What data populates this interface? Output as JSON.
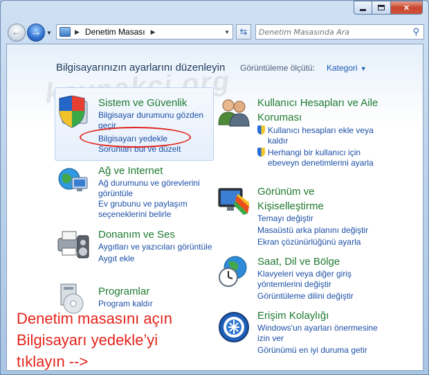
{
  "address": {
    "location": "Denetim Masası",
    "icon": "control-panel-icon"
  },
  "search": {
    "placeholder": "Denetim Masasında Ara"
  },
  "header": {
    "title": "Bilgisayarınızın ayarlarını düzenleyin",
    "view_by_label": "Görüntüleme ölçütü:",
    "view_by_value": "Kategori"
  },
  "watermark": "kaynakci.org",
  "categories_left": [
    {
      "title": "Sistem ve Güvenlik",
      "icon": "shield-pc-icon",
      "links": [
        "Bilgisayar durumunu gözden geçir",
        "Bilgisayarı yedekle",
        "Sorunları bul ve düzelt"
      ]
    },
    {
      "title": "Ağ ve Internet",
      "icon": "network-globe-icon",
      "links": [
        "Ağ durumunu ve görevlerini görüntüle",
        "Ev grubunu ve paylaşım seçeneklerini belirle"
      ]
    },
    {
      "title": "Donanım ve Ses",
      "icon": "printer-speaker-icon",
      "links": [
        "Aygıtları ve yazıcıları görüntüle",
        "Aygıt ekle"
      ]
    },
    {
      "title": "Programlar",
      "icon": "programs-disc-icon",
      "links": [
        "Program kaldır"
      ]
    }
  ],
  "categories_right": [
    {
      "title": "Kullanıcı Hesapları ve Aile Koruması",
      "icon": "users-icon",
      "links": [
        "Kullanıcı hesapları ekle veya kaldır",
        "Herhangi bir kullanıcı için ebeveyn denetimlerini ayarla"
      ]
    },
    {
      "title": "Görünüm ve Kişiselleştirme",
      "icon": "monitor-palette-icon",
      "links": [
        "Temayı değiştir",
        "Masaüstü arka planını değiştir",
        "Ekran çözünürlüğünü ayarla"
      ]
    },
    {
      "title": "Saat, Dil ve Bölge",
      "icon": "clock-globe-icon",
      "links": [
        "Klavyeleri veya diğer giriş yöntemlerini değiştir",
        "Görüntüleme dilini değiştir"
      ]
    },
    {
      "title": "Erişim Kolaylığı",
      "icon": "ease-of-access-icon",
      "links": [
        "Windows'un ayarları önermesine izin ver",
        "Görünümü en iyi duruma getir"
      ]
    }
  ],
  "annotation": {
    "line1": "Denetim masasını açın",
    "line2": "Bilgisayarı yedekle’yi",
    "line3": "tıklayın -->",
    "color": "#e3231c"
  },
  "colors": {
    "category_title": "#1e7a30",
    "link": "#1c4fa6",
    "heading": "#1e395b"
  }
}
